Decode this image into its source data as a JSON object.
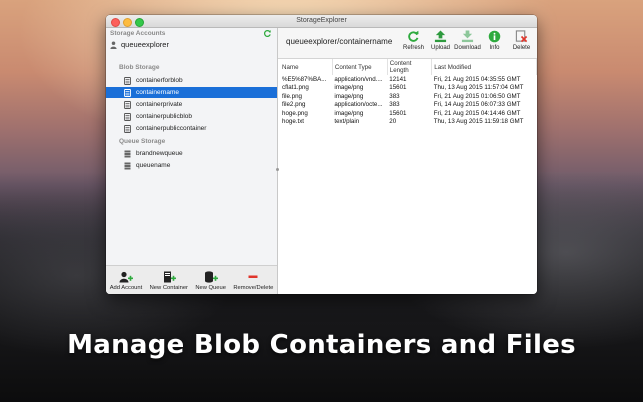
{
  "window": {
    "title": "StorageExplorer"
  },
  "sidebar": {
    "section_storage_accounts": "Storage Accounts",
    "account_name": "queueexplorer",
    "blob_storage_label": "Blob Storage",
    "blob_containers": [
      "containerforblob",
      "containername",
      "containerprivate",
      "containerpublicblob",
      "containerpubliccontainer"
    ],
    "selected_container": "containername",
    "queue_storage_label": "Queue Storage",
    "queues": [
      "brandnewqueue",
      "queuename"
    ],
    "bottom_buttons": [
      "Add Account",
      "New Container",
      "New Queue",
      "Remove/Delete"
    ]
  },
  "toolbar": {
    "path": "queueexplorer/containername",
    "buttons": [
      "Refresh",
      "Upload",
      "Download",
      "Info",
      "Delete"
    ]
  },
  "table": {
    "headers": [
      "Name",
      "Content Type",
      "Content Length",
      "Last Modified"
    ],
    "rows": [
      [
        "%E5%87%BA...",
        "application/vnd....",
        "12141",
        "Fri, 21 Aug 2015 04:35:55 GMT"
      ],
      [
        "cflat1.png",
        "image/png",
        "15601",
        "Thu, 13 Aug 2015 11:57:04 GMT"
      ],
      [
        "file.png",
        "image/png",
        "383",
        "Fri, 21 Aug 2015 01:06:50 GMT"
      ],
      [
        "file2.png",
        "application/octe...",
        "383",
        "Fri, 14 Aug 2015 06:07:33 GMT"
      ],
      [
        "hoge.png",
        "image/png",
        "15601",
        "Fri, 21 Aug 2015 04:14:46 GMT"
      ],
      [
        "hoge.txt",
        "text/plain",
        "20",
        "Thu, 13 Aug 2015 11:59:18 GMT"
      ]
    ]
  },
  "caption": "Manage Blob Containers and Files",
  "colors": {
    "selection": "#1a6fd8",
    "accent_green": "#2eaa3e",
    "delete_red": "#e0352b"
  }
}
